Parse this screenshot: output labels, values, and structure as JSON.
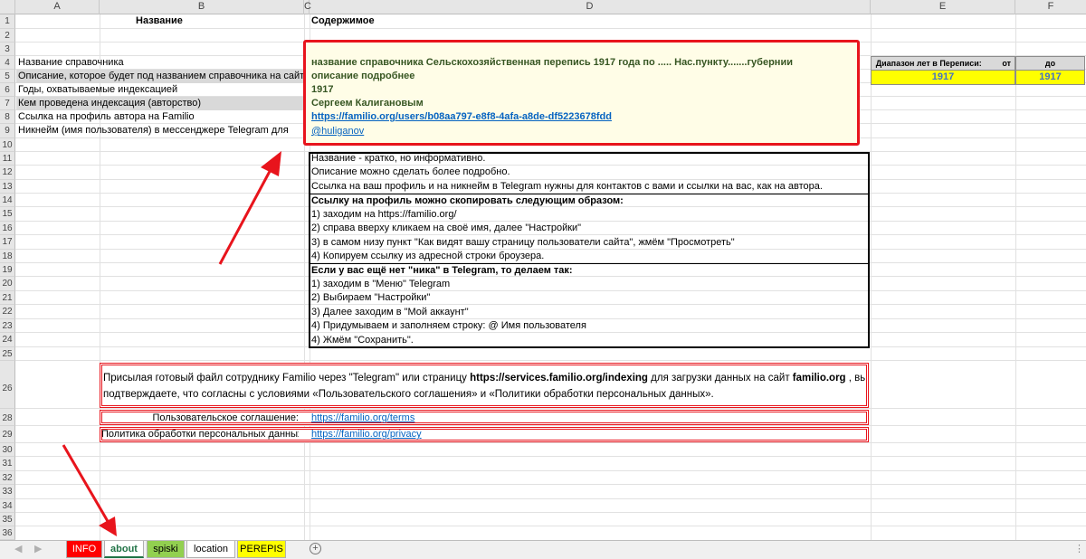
{
  "columns": [
    "A",
    "B",
    "C",
    "D",
    "E",
    "F"
  ],
  "rows": [
    "1",
    "2",
    "3",
    "4",
    "5",
    "6",
    "7",
    "8",
    "9",
    "10",
    "11",
    "12",
    "13",
    "14",
    "15",
    "16",
    "17",
    "18",
    "19",
    "20",
    "21",
    "22",
    "23",
    "24",
    "25",
    "26",
    "28",
    "29",
    "30",
    "31",
    "32",
    "33",
    "34",
    "35",
    "36"
  ],
  "header": {
    "name_col": "Название",
    "content_col": "Содержимое"
  },
  "labels": [
    "Название справочника",
    "Описание, которое будет под названием справочника на сайте",
    "Годы, охватываемые индексацией",
    "Кем проведена индексация (авторство)",
    "Ссылка на профиль автора на Familio",
    "Никнейм (имя пользователя) в мессенджере Telegram для"
  ],
  "values": {
    "title": "название справочника Сельскохозяйственная перепись 1917 года по ..... Нас.пункту.......губернии",
    "description": "описание подробнее",
    "years": "1917",
    "author": "Сергеем Калигановым",
    "profile_link": "https://familio.org/users/b08aa797-e8f8-4afa-a8de-df5223678fdd",
    "telegram": "@huliganov"
  },
  "census": {
    "label": "Диапазон лет в Переписи:",
    "from_label": "от",
    "to_label": "до",
    "from_value": "1917",
    "to_value": "1917"
  },
  "instructions": [
    "Название - кратко, но информативно.",
    "Описание можно сделать более подробно.",
    "Ссылка на ваш профиль и на никнейм в Telegram нужны для контактов с вами и ссылки на вас, как на автора.",
    "Ссылку на профиль можно скопировать следующим образом:",
    "1) заходим на https://familio.org/",
    "2) справа вверху кликаем на своё имя, далее \"Настройки\"",
    "3) в самом низу пункт \"Как видят вашу страницу пользователи сайта\", жмём \"Просмотреть\"",
    "4) Копируем ссылку из адресной строки броузера.",
    "Если у вас ещё нет \"ника\" в Telegram, то делаем так:",
    "1) заходим в \"Меню\" Telegram",
    "2) Выбираем \"Настройки\"",
    "3) Далее заходим в \"Мой аккаунт\"",
    "4) Придумываем и заполняем строку: @ Имя пользователя",
    "4) Жмём \"Сохранить\"."
  ],
  "agreement": {
    "text_1": "Присылая готовый файл сотруднику Familio через \"Telegram\" или страницу ",
    "url_1": "https://services.familio.org/indexing",
    "text_2": "  для загрузки данных на сайт ",
    "site": "familio.org",
    "text_3": " , вы",
    "line_2": "подтверждаете, что согласны с условиями «Пользовательского соглашения» и «Политики обработки персональных данных».",
    "terms_label": "Пользовательское соглашение:",
    "terms_link": "https://familio.org/terms",
    "privacy_label": "Политика обработки персональных данных:",
    "privacy_link": "https://familio.org/privacy"
  },
  "tabs": {
    "info": "INFO",
    "about": "about",
    "spiski": "spiski",
    "location": "location",
    "perepis": "PEREPIS"
  },
  "colors": {
    "red_annotation": "#e8141c",
    "green_text": "#375623",
    "link": "#0563c1",
    "yellow_fill": "#ffff00",
    "info_tab": "#ff0000",
    "spiski_tab": "#92d050",
    "perepis_tab": "#ffff00"
  }
}
